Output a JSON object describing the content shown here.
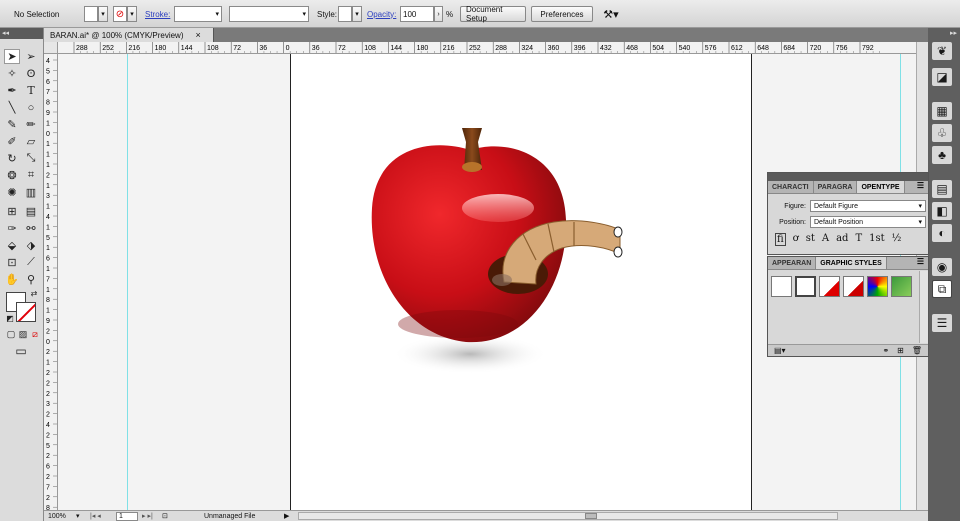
{
  "control_bar": {
    "selection": "No Selection",
    "stroke_label": "Stroke:",
    "style_label": "Style:",
    "opacity_label": "Opacity:",
    "opacity_value": "100",
    "percent": "%",
    "document_setup": "Document Setup",
    "preferences": "Preferences"
  },
  "document_tab": {
    "title": "BARAN.ai* @ 100% (CMYK/Preview)",
    "close": "×"
  },
  "rulers": {
    "horizontal": [
      "288",
      "252",
      "216",
      "180",
      "144",
      "108",
      "72",
      "36",
      "0",
      "36",
      "72",
      "108",
      "144",
      "180",
      "216",
      "252",
      "288",
      "324",
      "360",
      "396",
      "432",
      "468",
      "504",
      "540",
      "576",
      "612",
      "648",
      "684",
      "720",
      "756",
      "792"
    ],
    "vertical": [
      "4",
      "5",
      "6",
      "7",
      "8",
      "9",
      "1",
      "0",
      "1",
      "1",
      "1",
      "2",
      "1",
      "3",
      "1",
      "4",
      "1",
      "5",
      "1",
      "6",
      "1",
      "7",
      "1",
      "8",
      "1",
      "9",
      "2",
      "0",
      "2",
      "1",
      "2",
      "2",
      "2",
      "3",
      "2",
      "4",
      "2",
      "5",
      "2",
      "6",
      "2",
      "7",
      "2",
      "8"
    ]
  },
  "status_bar": {
    "zoom": "100%",
    "page": "1",
    "info": "Unmanaged File"
  },
  "panels": {
    "type_tabs": [
      "CHARACTI",
      "PARAGRA",
      "OPENTYPE"
    ],
    "figure_label": "Figure:",
    "figure_value": "Default Figure",
    "position_label": "Position:",
    "position_value": "Default Position",
    "opentype_glyphs": [
      "ﬁ",
      "ơ",
      "st",
      "A",
      "ad",
      "T",
      "1st",
      "½"
    ],
    "style_tabs": [
      "APPEARAN",
      "GRAPHIC STYLES"
    ]
  },
  "colors": {
    "apple_red": "#d0121a",
    "apple_dark": "#7a0a0c",
    "worm_tan": "#d6a978",
    "stem_brown": "#6a3510",
    "guide_cyan": "#7fe0e6"
  }
}
